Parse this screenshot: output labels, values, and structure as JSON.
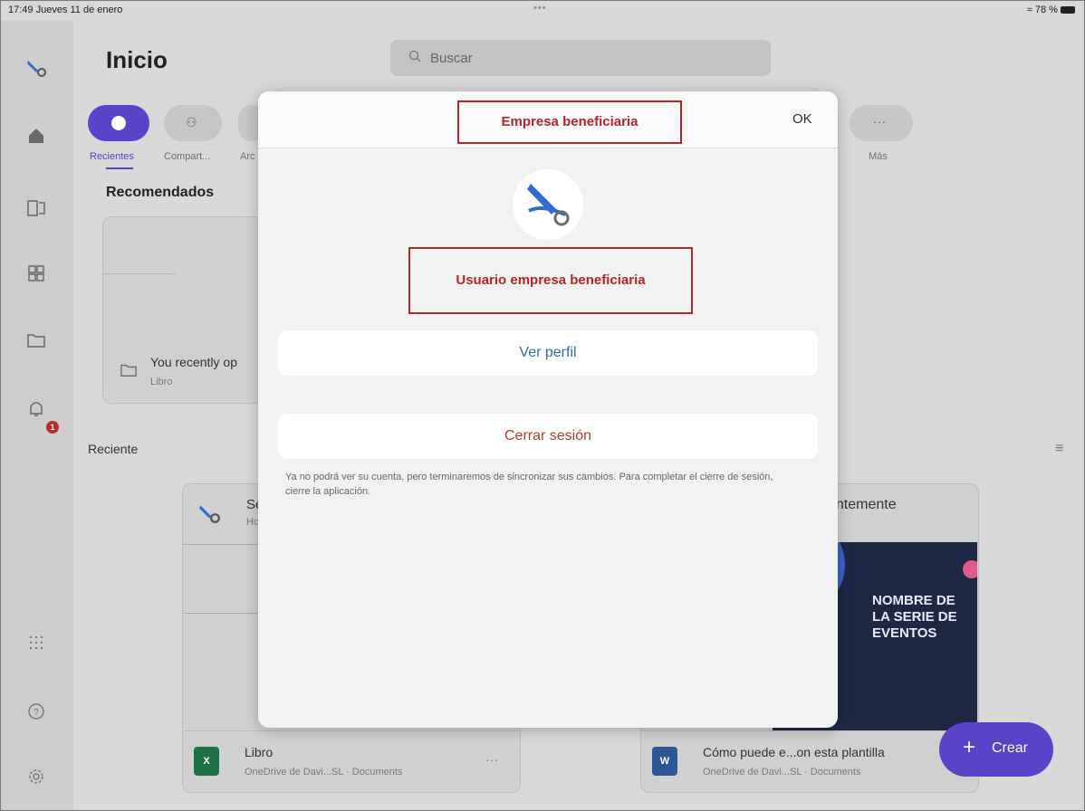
{
  "status_bar": {
    "time_date": "17:49  Jueves 11 de enero",
    "dots": "•••",
    "battery": "78 %"
  },
  "page": {
    "title": "Inicio"
  },
  "search": {
    "placeholder": "Buscar"
  },
  "tabs": [
    {
      "label": "Recientes",
      "active": true
    },
    {
      "label": "Compart..."
    },
    {
      "label": "Arc"
    },
    {
      "label": "Más"
    }
  ],
  "notifications": {
    "count": "1"
  },
  "recommended": {
    "title": "Recomendados",
    "card": {
      "title": "You recently op",
      "subtitle": "Libro"
    }
  },
  "recent": {
    "title": "Reciente",
    "left_card": {
      "header_title": "Se",
      "header_subtitle": "Hc",
      "file_name": "Libro",
      "file_location": "OneDrive de Davi...SL · Documents",
      "more": "···"
    },
    "right_card": {
      "header_title": "entemente",
      "poster_text": "NOMBRE DE LA SERIE DE EVENTOS",
      "file_name": "Cómo puede e...on esta plantilla",
      "file_location": "OneDrive de Davi...SL · Documents"
    }
  },
  "fab": {
    "label": "Crear"
  },
  "modal": {
    "title": "Empresa beneficiaria",
    "ok": "OK",
    "user_name": "Usuario empresa beneficiaria",
    "profile_button": "Ver perfil",
    "logout_button": "Cerrar sesión",
    "logout_note": "Ya no podrá ver su cuenta, pero terminaremos de sincronizar sus cambios. Para completar el cierre de sesión, cierre la aplicación."
  },
  "colors": {
    "accent": "#5a43c9",
    "danger": "#b3262b",
    "link": "#2f6da8",
    "excel": "#1e7145",
    "word": "#2b5797"
  }
}
